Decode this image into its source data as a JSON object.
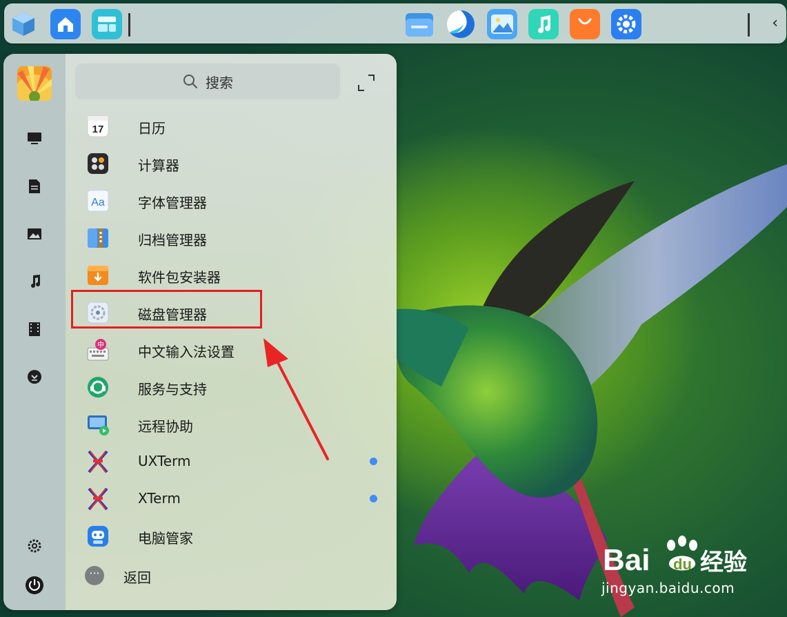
{
  "dock": {
    "left_icons": [
      "system-cube-icon",
      "home-folder-icon",
      "multitask-view-icon"
    ],
    "apps": [
      "file-manager-icon",
      "browser-icon",
      "image-viewer-icon",
      "music-icon",
      "app-store-icon",
      "settings-icon"
    ],
    "collapse_glyph": "‹"
  },
  "sidebar": {
    "items": [
      {
        "name": "computer-icon"
      },
      {
        "name": "document-icon"
      },
      {
        "name": "picture-icon"
      },
      {
        "name": "music-icon"
      },
      {
        "name": "video-icon"
      },
      {
        "name": "download-icon"
      },
      {
        "name": "settings-gear-icon"
      },
      {
        "name": "power-icon"
      }
    ]
  },
  "search": {
    "placeholder": "搜索"
  },
  "apps": [
    {
      "label": "日历",
      "icon": "calendar-icon",
      "icon_text": "17",
      "new": false
    },
    {
      "label": "计算器",
      "icon": "calculator-icon",
      "new": false
    },
    {
      "label": "字体管理器",
      "icon": "font-manager-icon",
      "icon_text": "Aa",
      "new": false
    },
    {
      "label": "归档管理器",
      "icon": "archive-manager-icon",
      "new": false
    },
    {
      "label": "软件包安装器",
      "icon": "package-installer-icon",
      "new": false
    },
    {
      "label": "磁盘管理器",
      "icon": "disk-manager-icon",
      "new": false
    },
    {
      "label": "中文输入法设置",
      "icon": "input-method-icon",
      "icon_text": "中",
      "new": false
    },
    {
      "label": "服务与支持",
      "icon": "support-icon",
      "new": false
    },
    {
      "label": "远程协助",
      "icon": "remote-assist-icon",
      "new": false
    },
    {
      "label": "UXTerm",
      "icon": "xterm-x-icon",
      "new": true
    },
    {
      "label": "XTerm",
      "icon": "xterm-x-icon",
      "new": true
    },
    {
      "label": "电脑管家",
      "icon": "pc-manager-icon",
      "new": false
    }
  ],
  "back": {
    "label": "返回",
    "glyph": "···"
  },
  "watermark": {
    "logo_text": "Bai",
    "logo_text2": "du",
    "logo_suffix": "经验",
    "url": "jingyan.baidu.com"
  },
  "colors": {
    "highlight": "#e02020",
    "new_dot": "#3d8df5"
  }
}
